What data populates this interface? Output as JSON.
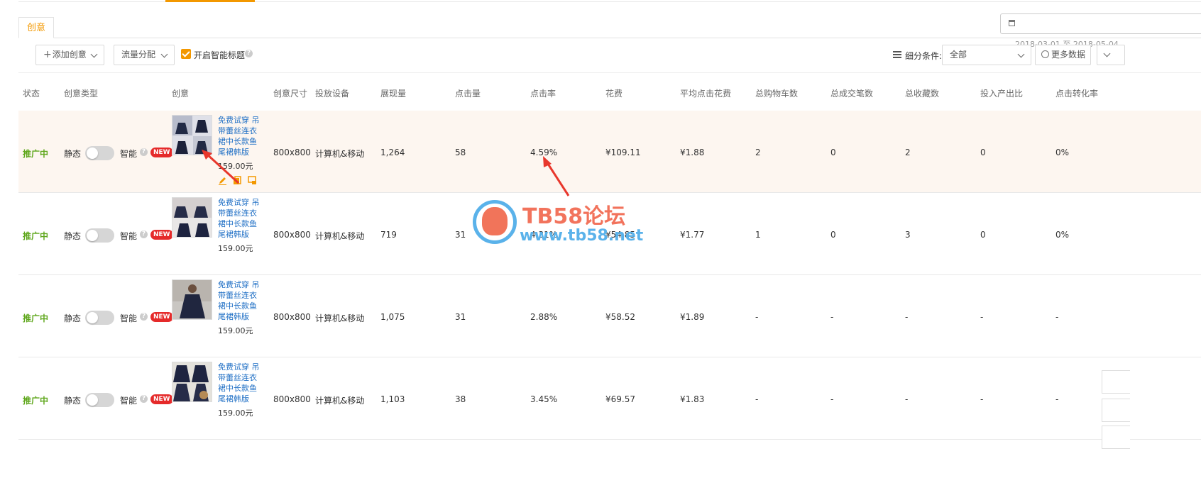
{
  "tabs": {
    "active": "创意"
  },
  "date": {
    "range": "2018-03-01 至 2018-05-04"
  },
  "toolbar": {
    "add_creative": "添加创意",
    "traffic": "流量分配",
    "smart_title": "开启智能标题",
    "smart_title_checked": true,
    "segment_label": "细分条件:",
    "segment_value": "全部",
    "more_data": "更多数据"
  },
  "columns": [
    "状态",
    "创意类型",
    "创意",
    "创意尺寸",
    "投放设备",
    "展现量",
    "点击量",
    "点击率",
    "花费",
    "平均点击花费",
    "总购物车数",
    "总成交笔数",
    "总收藏数",
    "投入产出比",
    "点击转化率"
  ],
  "rows": [
    {
      "status": "推广中",
      "type_static": "静态",
      "type_smart": "智能",
      "badge": "NEW",
      "title": "免费试穿 吊带蕾丝连衣裙中长款鱼尾裙韩版",
      "price": "159.00元",
      "size": "800x800",
      "device": "计算机&移动",
      "impressions": "1,264",
      "clicks": "58",
      "ctr": "4.59%",
      "cost": "¥109.11",
      "cpc": "¥1.88",
      "carts": "2",
      "orders": "0",
      "favs": "2",
      "roi": "0",
      "cvr": "0%"
    },
    {
      "status": "推广中",
      "type_static": "静态",
      "type_smart": "智能",
      "badge": "NEW",
      "title": "免费试穿 吊带蕾丝连衣裙中长款鱼尾裙韩版",
      "price": "159.00元",
      "size": "800x800",
      "device": "计算机&移动",
      "impressions": "719",
      "clicks": "31",
      "ctr": "4.31%",
      "cost": "¥54.85",
      "cpc": "¥1.77",
      "carts": "1",
      "orders": "0",
      "favs": "3",
      "roi": "0",
      "cvr": "0%"
    },
    {
      "status": "推广中",
      "type_static": "静态",
      "type_smart": "智能",
      "badge": "NEW",
      "title": "免费试穿 吊带蕾丝连衣裙中长款鱼尾裙韩版",
      "price": "159.00元",
      "size": "800x800",
      "device": "计算机&移动",
      "impressions": "1,075",
      "clicks": "31",
      "ctr": "2.88%",
      "cost": "¥58.52",
      "cpc": "¥1.89",
      "carts": "-",
      "orders": "-",
      "favs": "-",
      "roi": "-",
      "cvr": "-"
    },
    {
      "status": "推广中",
      "type_static": "静态",
      "type_smart": "智能",
      "badge": "NEW",
      "title": "免费试穿 吊带蕾丝连衣裙中长款鱼尾裙韩版",
      "price": "159.00元",
      "size": "800x800",
      "device": "计算机&移动",
      "impressions": "1,103",
      "clicks": "38",
      "ctr": "3.45%",
      "cost": "¥69.57",
      "cpc": "¥1.83",
      "carts": "-",
      "orders": "-",
      "favs": "-",
      "roi": "-",
      "cvr": "-"
    }
  ],
  "watermark": {
    "title": "TB58论坛",
    "url": "www.tb58.net"
  },
  "colors": {
    "accent": "#f39800",
    "status": "#5fa71c",
    "link": "#1f6fc5",
    "badge": "#e52a2a",
    "arrow": "#e8372c"
  }
}
